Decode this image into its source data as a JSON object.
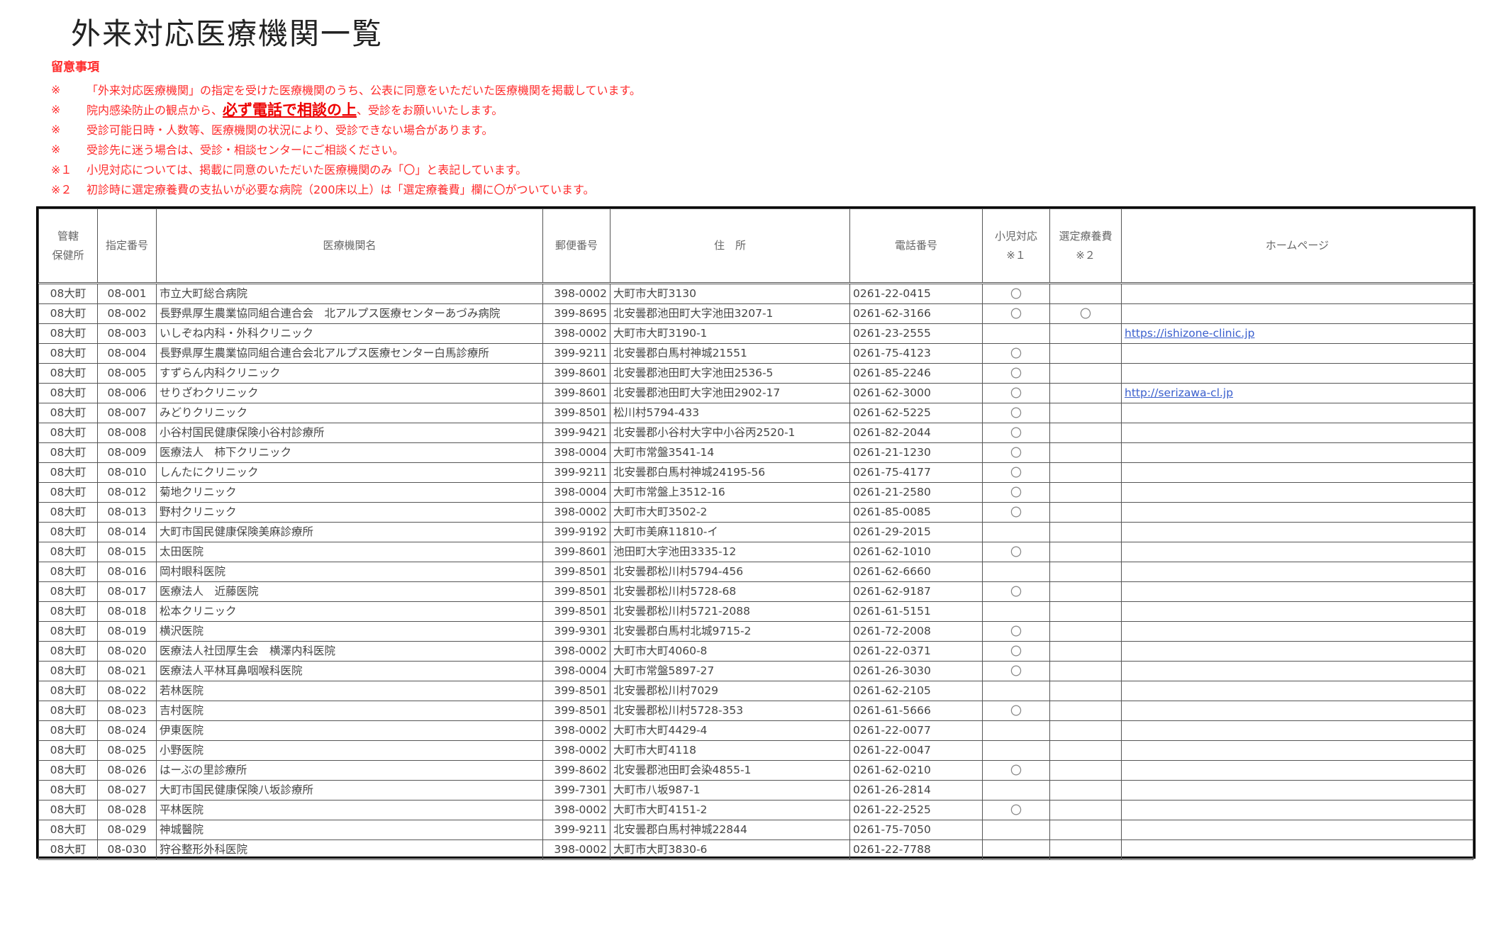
{
  "title": "外来対応医療機関一覧",
  "notes": {
    "heading": "留意事項",
    "items": [
      {
        "mark": "※",
        "text": "「外来対応医療機関」の指定を受けた医療機関のうち、公表に同意をいただいた医療機関を掲載しています。"
      },
      {
        "mark": "※",
        "pre": "院内感染防止の観点から、",
        "emph": "必ず電話で相談の上",
        "post": "、受診をお願いいたします。"
      },
      {
        "mark": "※",
        "text": "受診可能日時・人数等、医療機関の状況により、受診できない場合があります。"
      },
      {
        "mark": "※",
        "text": "受診先に迷う場合は、受診・相談センターにご相談ください。"
      },
      {
        "mark": "※１",
        "text": "小児対応については、掲載に同意のいただいた医療機関のみ「〇」と表記しています。"
      },
      {
        "mark": "※２",
        "text": "初診時に選定療養費の支払いが必要な病院（200床以上）は「選定療養費」欄に〇がついています。"
      }
    ]
  },
  "table": {
    "headers": {
      "office_l1": "管轄",
      "office_l2": "保健所",
      "id": "指定番号",
      "name": "医療機関名",
      "zip": "郵便番号",
      "address": "住　所",
      "phone": "電話番号",
      "child_l1": "小児対応",
      "child_l2": "※１",
      "fee_l1": "選定療養費",
      "fee_l2": "※２",
      "homepage": "ホームページ"
    },
    "rows": [
      {
        "office": "08大町",
        "id": "08-001",
        "name": "市立大町総合病院",
        "zip": "398-0002",
        "address": "大町市大町3130",
        "phone": "0261-22-0415",
        "child": "〇",
        "fee": "",
        "url": ""
      },
      {
        "office": "08大町",
        "id": "08-002",
        "name": "長野県厚生農業協同組合連合会　北アルプス医療センターあづみ病院",
        "zip": "399-8695",
        "address": "北安曇郡池田町大字池田3207-1",
        "phone": "0261-62-3166",
        "child": "〇",
        "fee": "〇",
        "url": ""
      },
      {
        "office": "08大町",
        "id": "08-003",
        "name": "いしぞね内科・外科クリニック",
        "zip": "398-0002",
        "address": "大町市大町3190-1",
        "phone": "0261-23-2555",
        "child": "",
        "fee": "",
        "url": "https://ishizone-clinic.jp"
      },
      {
        "office": "08大町",
        "id": "08-004",
        "name": "長野県厚生農業協同組合連合会北アルプス医療センター白馬診療所",
        "zip": "399-9211",
        "address": "北安曇郡白馬村神城21551",
        "phone": "0261-75-4123",
        "child": "〇",
        "fee": "",
        "url": ""
      },
      {
        "office": "08大町",
        "id": "08-005",
        "name": "すずらん内科クリニック",
        "zip": "399-8601",
        "address": "北安曇郡池田町大字池田2536-5",
        "phone": "0261-85-2246",
        "child": "〇",
        "fee": "",
        "url": ""
      },
      {
        "office": "08大町",
        "id": "08-006",
        "name": "せりざわクリニック",
        "zip": "399-8601",
        "address": "北安曇郡池田町大字池田2902-17",
        "phone": "0261-62-3000",
        "child": "〇",
        "fee": "",
        "url": "http://serizawa-cl.jp"
      },
      {
        "office": "08大町",
        "id": "08-007",
        "name": "みどりクリニック",
        "zip": "399-8501",
        "address": "松川村5794-433",
        "phone": "0261-62-5225",
        "child": "〇",
        "fee": "",
        "url": ""
      },
      {
        "office": "08大町",
        "id": "08-008",
        "name": "小谷村国民健康保険小谷村診療所",
        "zip": "399-9421",
        "address": "北安曇郡小谷村大字中小谷丙2520-1",
        "phone": "0261-82-2044",
        "child": "〇",
        "fee": "",
        "url": ""
      },
      {
        "office": "08大町",
        "id": "08-009",
        "name": "医療法人　柿下クリニック",
        "zip": "398-0004",
        "address": "大町市常盤3541-14",
        "phone": "0261-21-1230",
        "child": "〇",
        "fee": "",
        "url": ""
      },
      {
        "office": "08大町",
        "id": "08-010",
        "name": "しんたにクリニック",
        "zip": "399-9211",
        "address": "北安曇郡白馬村神城24195-56",
        "phone": "0261-75-4177",
        "child": "〇",
        "fee": "",
        "url": ""
      },
      {
        "office": "08大町",
        "id": "08-012",
        "name": "菊地クリニック",
        "zip": "398-0004",
        "address": "大町市常盤上3512-16",
        "phone": "0261-21-2580",
        "child": "〇",
        "fee": "",
        "url": ""
      },
      {
        "office": "08大町",
        "id": "08-013",
        "name": "野村クリニック",
        "zip": "398-0002",
        "address": "大町市大町3502-2",
        "phone": "0261-85-0085",
        "child": "〇",
        "fee": "",
        "url": ""
      },
      {
        "office": "08大町",
        "id": "08-014",
        "name": "大町市国民健康保険美麻診療所",
        "zip": "399-9192",
        "address": "大町市美麻11810-イ",
        "phone": "0261-29-2015",
        "child": "",
        "fee": "",
        "url": ""
      },
      {
        "office": "08大町",
        "id": "08-015",
        "name": "太田医院",
        "zip": "399-8601",
        "address": "池田町大字池田3335-12",
        "phone": "0261-62-1010",
        "child": "〇",
        "fee": "",
        "url": ""
      },
      {
        "office": "08大町",
        "id": "08-016",
        "name": "岡村眼科医院",
        "zip": "399-8501",
        "address": "北安曇郡松川村5794-456",
        "phone": "0261-62-6660",
        "child": "",
        "fee": "",
        "url": ""
      },
      {
        "office": "08大町",
        "id": "08-017",
        "name": "医療法人　近藤医院",
        "zip": "399-8501",
        "address": "北安曇郡松川村5728-68",
        "phone": "0261-62-9187",
        "child": "〇",
        "fee": "",
        "url": ""
      },
      {
        "office": "08大町",
        "id": "08-018",
        "name": "松本クリニック",
        "zip": "399-8501",
        "address": "北安曇郡松川村5721-2088",
        "phone": "0261-61-5151",
        "child": "",
        "fee": "",
        "url": ""
      },
      {
        "office": "08大町",
        "id": "08-019",
        "name": "横沢医院",
        "zip": "399-9301",
        "address": "北安曇郡白馬村北城9715-2",
        "phone": "0261-72-2008",
        "child": "〇",
        "fee": "",
        "url": ""
      },
      {
        "office": "08大町",
        "id": "08-020",
        "name": "医療法人社団厚生会　横澤内科医院",
        "zip": "398-0002",
        "address": "大町市大町4060-8",
        "phone": "0261-22-0371",
        "child": "〇",
        "fee": "",
        "url": ""
      },
      {
        "office": "08大町",
        "id": "08-021",
        "name": "医療法人平林耳鼻咽喉科医院",
        "zip": "398-0004",
        "address": "大町市常盤5897-27",
        "phone": "0261-26-3030",
        "child": "〇",
        "fee": "",
        "url": ""
      },
      {
        "office": "08大町",
        "id": "08-022",
        "name": "若林医院",
        "zip": "399-8501",
        "address": "北安曇郡松川村7029",
        "phone": "0261-62-2105",
        "child": "",
        "fee": "",
        "url": ""
      },
      {
        "office": "08大町",
        "id": "08-023",
        "name": "吉村医院",
        "zip": "399-8501",
        "address": "北安曇郡松川村5728-353",
        "phone": "0261-61-5666",
        "child": "〇",
        "fee": "",
        "url": ""
      },
      {
        "office": "08大町",
        "id": "08-024",
        "name": "伊東医院",
        "zip": "398-0002",
        "address": "大町市大町4429-4",
        "phone": "0261-22-0077",
        "child": "",
        "fee": "",
        "url": ""
      },
      {
        "office": "08大町",
        "id": "08-025",
        "name": "小野医院",
        "zip": "398-0002",
        "address": "大町市大町4118",
        "phone": "0261-22-0047",
        "child": "",
        "fee": "",
        "url": ""
      },
      {
        "office": "08大町",
        "id": "08-026",
        "name": "はーぶの里診療所",
        "zip": "399-8602",
        "address": "北安曇郡池田町会染4855-1",
        "phone": "0261-62-0210",
        "child": "〇",
        "fee": "",
        "url": ""
      },
      {
        "office": "08大町",
        "id": "08-027",
        "name": "大町市国民健康保険八坂診療所",
        "zip": "399-7301",
        "address": "大町市八坂987-1",
        "phone": "0261-26-2814",
        "child": "",
        "fee": "",
        "url": ""
      },
      {
        "office": "08大町",
        "id": "08-028",
        "name": "平林医院",
        "zip": "398-0002",
        "address": "大町市大町4151-2",
        "phone": "0261-22-2525",
        "child": "〇",
        "fee": "",
        "url": ""
      },
      {
        "office": "08大町",
        "id": "08-029",
        "name": "神城醫院",
        "zip": "399-9211",
        "address": "北安曇郡白馬村神城22844",
        "phone": "0261-75-7050",
        "child": "",
        "fee": "",
        "url": ""
      },
      {
        "office": "08大町",
        "id": "08-030",
        "name": "狩谷整形外科医院",
        "zip": "398-0002",
        "address": "大町市大町3830-6",
        "phone": "0261-22-7788",
        "child": "",
        "fee": "",
        "url": ""
      }
    ]
  }
}
